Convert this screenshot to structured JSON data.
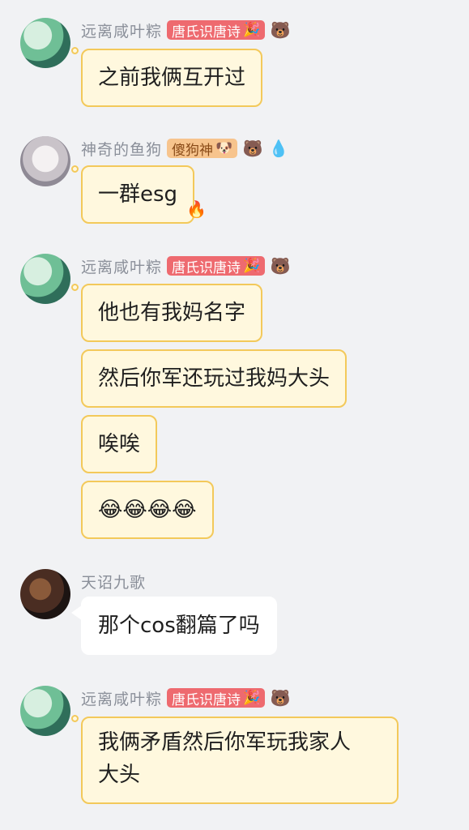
{
  "messages": [
    {
      "name": "远离咸叶粽",
      "badge": "唐氏识唐诗",
      "badge_icon": "firework-icon",
      "extra_icon": "bear-face-icon",
      "text": "之前我俩互开过"
    },
    {
      "name": "神奇的鱼狗",
      "badge": "傻狗神",
      "badge_icon": "dog-face-icon",
      "extra_icons": [
        "crown-bear-icon",
        "water-drop-icon"
      ],
      "text": "一群esg",
      "bubble_icon": "flame-icon"
    },
    {
      "name": "远离咸叶粽",
      "badge": "唐氏识唐诗",
      "badge_icon": "firework-icon",
      "extra_icon": "bear-face-icon",
      "texts": [
        "他也有我妈名字",
        "然后你军还玩过我妈大头",
        "唉唉",
        "😂😂😂😂"
      ]
    },
    {
      "name": "天诏九歌",
      "text": "那个cos翻篇了吗"
    },
    {
      "name": "远离咸叶粽",
      "badge": "唐氏识唐诗",
      "badge_icon": "firework-icon",
      "extra_icon": "bear-face-icon",
      "text_lines": [
        "我俩矛盾然后你军玩我家人",
        "大头"
      ]
    }
  ],
  "colors": {
    "background": "#f1f2f4",
    "bubble_yellow": "#fff8de",
    "bubble_border": "#f3c95a",
    "badge_red": "#ee6a6f",
    "badge_orange": "#f7c48d"
  }
}
